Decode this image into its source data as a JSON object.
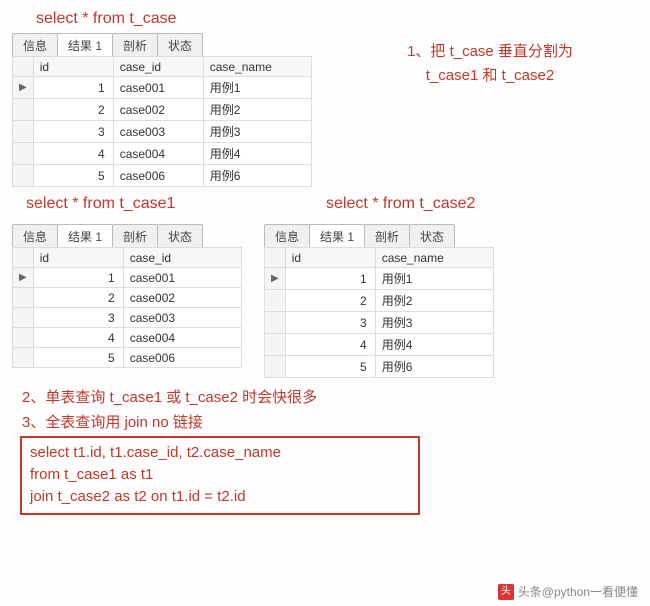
{
  "query1": "select * from t_case",
  "query2": "select * from t_case1",
  "query3": "select * from t_case2",
  "annotation1_line1": "1、把 t_case 垂直分割为",
  "annotation1_line2": "t_case1 和 t_case2",
  "note2": "2、单表查询 t_case1 或 t_case2 时会快很多",
  "note3": "3、全表查询用 join no 链接",
  "sqlbox": {
    "l1": "select t1.id, t1.case_id, t2.case_name",
    "l2": "from t_case1 as t1",
    "l3": "join  t_case2 as t2 on t1.id = t2.id"
  },
  "tabs": {
    "info": "信息",
    "result": "结果 1",
    "profile": "剖析",
    "status": "状态"
  },
  "t_case": {
    "headers": {
      "id": "id",
      "case_id": "case_id",
      "case_name": "case_name"
    },
    "rows": [
      {
        "id": "1",
        "case_id": "case001",
        "case_name": "用例1"
      },
      {
        "id": "2",
        "case_id": "case002",
        "case_name": "用例2"
      },
      {
        "id": "3",
        "case_id": "case003",
        "case_name": "用例3"
      },
      {
        "id": "4",
        "case_id": "case004",
        "case_name": "用例4"
      },
      {
        "id": "5",
        "case_id": "case006",
        "case_name": "用例6"
      }
    ]
  },
  "t_case1": {
    "headers": {
      "id": "id",
      "case_id": "case_id"
    },
    "rows": [
      {
        "id": "1",
        "case_id": "case001"
      },
      {
        "id": "2",
        "case_id": "case002"
      },
      {
        "id": "3",
        "case_id": "case003"
      },
      {
        "id": "4",
        "case_id": "case004"
      },
      {
        "id": "5",
        "case_id": "case006"
      }
    ]
  },
  "t_case2": {
    "headers": {
      "id": "id",
      "case_name": "case_name"
    },
    "rows": [
      {
        "id": "1",
        "case_name": "用例1"
      },
      {
        "id": "2",
        "case_name": "用例2"
      },
      {
        "id": "3",
        "case_name": "用例3"
      },
      {
        "id": "4",
        "case_name": "用例4"
      },
      {
        "id": "5",
        "case_name": "用例6"
      }
    ]
  },
  "watermark": "头条@python一看便懂"
}
